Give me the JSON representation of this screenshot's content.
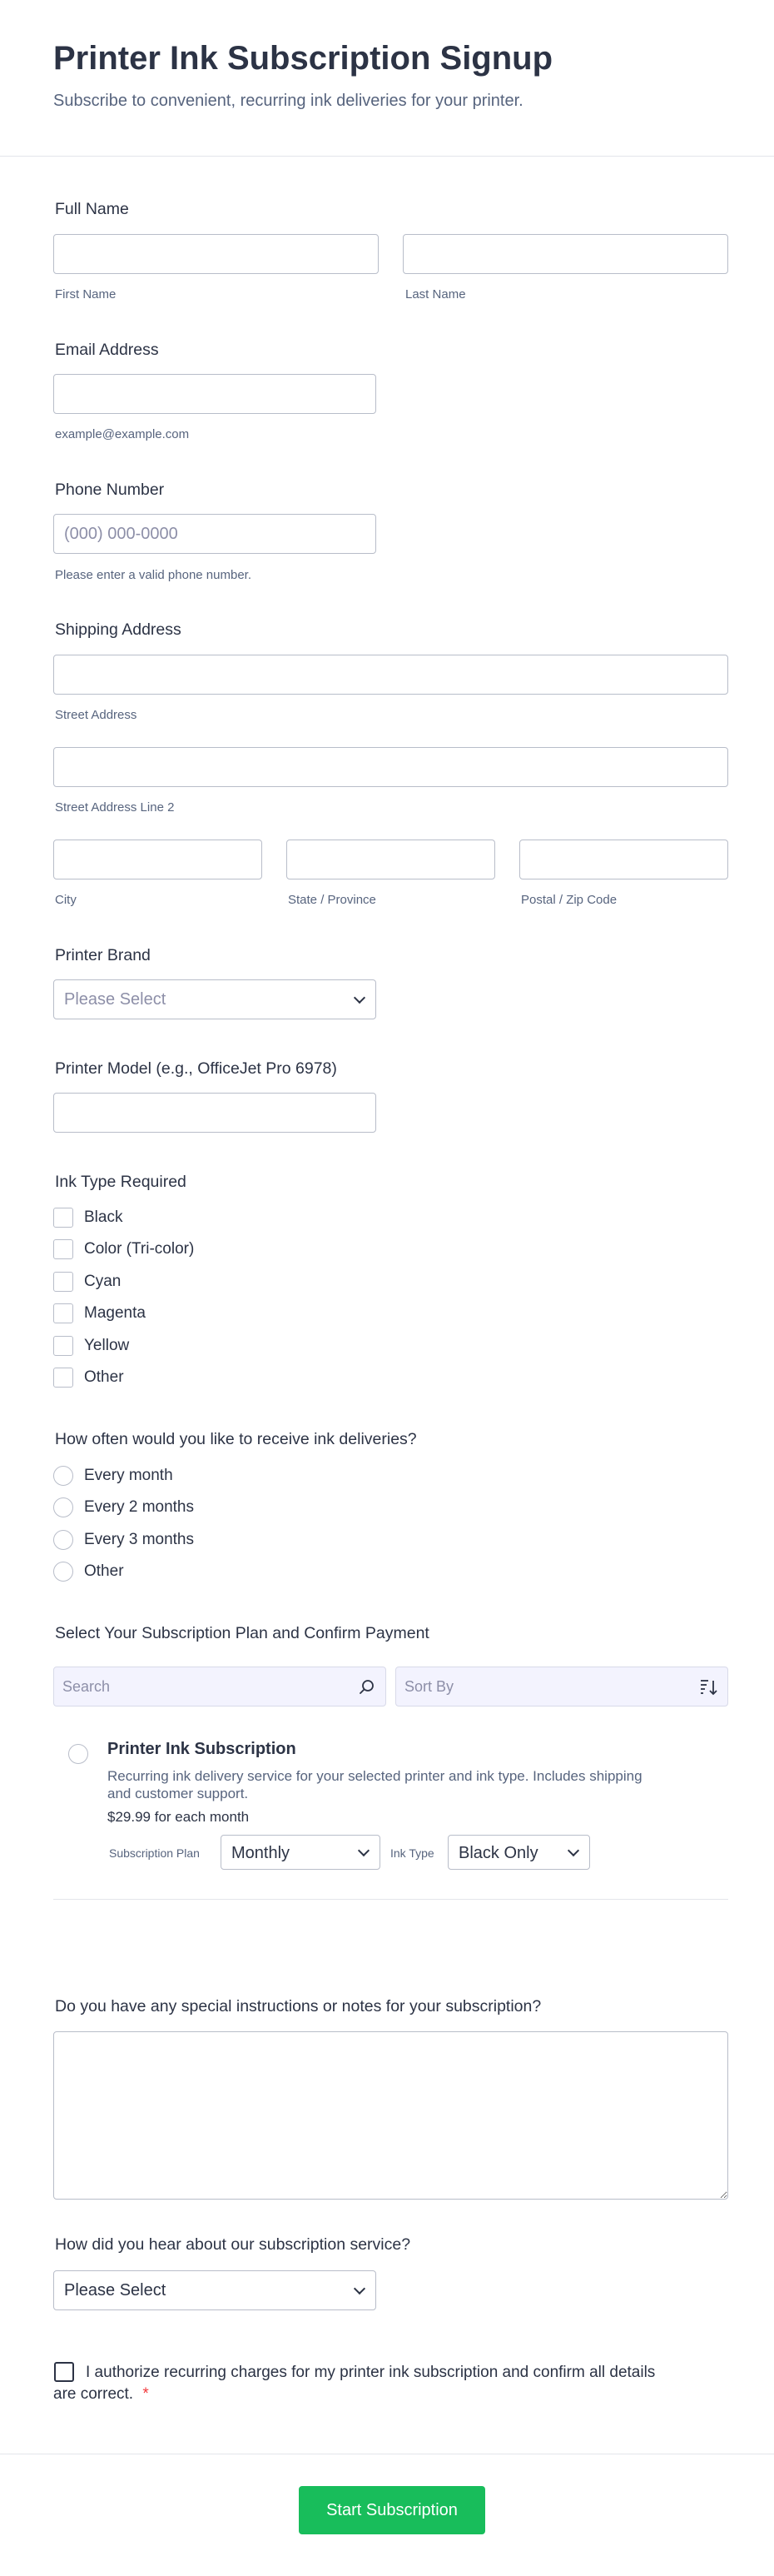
{
  "header": {
    "title": "Printer Ink Subscription Signup",
    "subtitle": "Subscribe to convenient, recurring ink deliveries for your printer."
  },
  "full_name": {
    "label": "Full Name",
    "first_sublabel": "First Name",
    "last_sublabel": "Last Name",
    "first_value": "",
    "last_value": ""
  },
  "email": {
    "label": "Email Address",
    "sublabel": "example@example.com",
    "value": ""
  },
  "phone": {
    "label": "Phone Number",
    "placeholder": "(000) 000-0000",
    "sublabel": "Please enter a valid phone number."
  },
  "address": {
    "label": "Shipping Address",
    "street_sublabel": "Street Address",
    "street2_sublabel": "Street Address Line 2",
    "city_sublabel": "City",
    "state_sublabel": "State / Province",
    "zip_sublabel": "Postal / Zip Code"
  },
  "printer_brand": {
    "label": "Printer Brand",
    "placeholder": "Please Select"
  },
  "printer_model": {
    "label": "Printer Model (e.g., OfficeJet Pro 6978)",
    "value": ""
  },
  "ink_type": {
    "label": "Ink Type Required",
    "options": [
      "Black",
      "Color (Tri-color)",
      "Cyan",
      "Magenta",
      "Yellow",
      "Other"
    ]
  },
  "frequency": {
    "label": "How often would you like to receive ink deliveries?",
    "options": [
      "Every month",
      "Every 2 months",
      "Every 3 months",
      "Other"
    ]
  },
  "plan": {
    "label": "Select Your Subscription Plan and Confirm Payment",
    "search_placeholder": "Search",
    "sort_placeholder": "Sort By",
    "product": {
      "name": "Printer Ink Subscription",
      "description": "Recurring ink delivery service for your selected printer and ink type. Includes shipping and customer support.",
      "price": "$29.99",
      "price_suffix": "for each month",
      "plan_label": "Subscription Plan",
      "plan_value": "Monthly",
      "ink_label": "Ink Type",
      "ink_value": "Black Only"
    }
  },
  "notes": {
    "label": "Do you have any special instructions or notes for your subscription?",
    "value": ""
  },
  "referral": {
    "label": "How did you hear about our subscription service?",
    "value": "Please Select"
  },
  "authorize": {
    "text": "I authorize recurring charges for my printer ink subscription and confirm all details are correct.",
    "required_mark": "*"
  },
  "submit": {
    "label": "Start Subscription"
  },
  "colors": {
    "accent": "#18bd5b",
    "text": "#2c3345",
    "muted": "#57647e",
    "border": "#b8bdc9",
    "required": "#f23a3c"
  }
}
